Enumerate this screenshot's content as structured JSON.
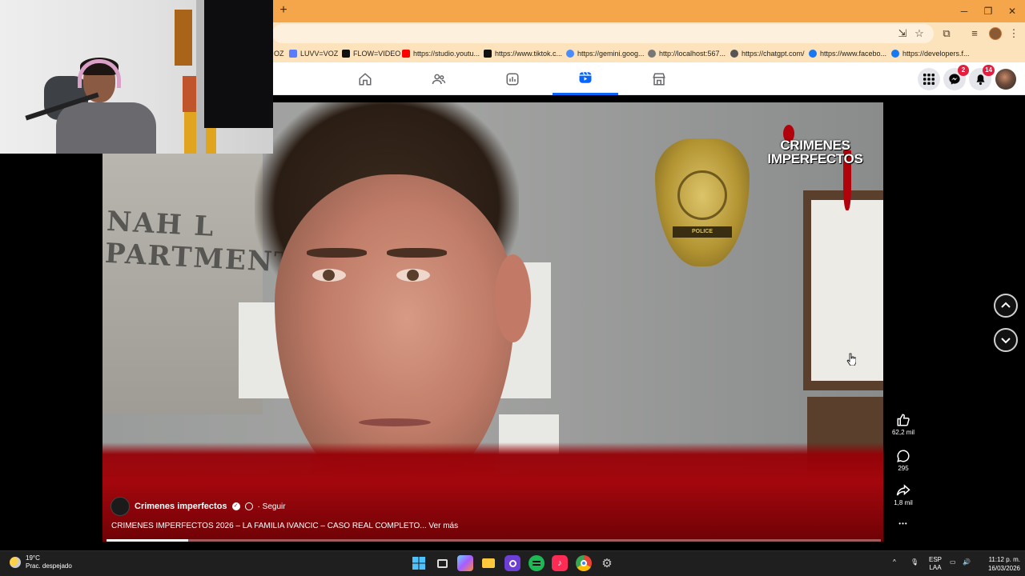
{
  "browser": {
    "new_tab_glyph": "+",
    "window_controls": [
      "─",
      "❐",
      "✕"
    ],
    "bookmarks": [
      {
        "label": "OZ",
        "icon_color": "#999999"
      },
      {
        "label": "LUVV=VOZ",
        "icon_color": "#5b7cff"
      },
      {
        "label": "FLOW=VIDEO",
        "icon_color": "#111111"
      },
      {
        "label": "https://studio.youtu...",
        "icon_color": "#ff0000"
      },
      {
        "label": "https://www.tiktok.c...",
        "icon_color": "#111111"
      },
      {
        "label": "https://gemini.goog...",
        "icon_color": "#4a8cff"
      },
      {
        "label": "http://localhost:567...",
        "icon_color": "#777777"
      },
      {
        "label": "https://chatgpt.com/",
        "icon_color": "#555555"
      },
      {
        "label": "https://www.facebo...",
        "icon_color": "#1877f2"
      },
      {
        "label": "https://developers.f...",
        "icon_color": "#1877f2"
      }
    ]
  },
  "facebook": {
    "nav_tabs": [
      {
        "name": "home-icon",
        "active": false
      },
      {
        "name": "friends-icon",
        "active": false
      },
      {
        "name": "feeds-icon",
        "active": false
      },
      {
        "name": "reels-icon",
        "active": true
      },
      {
        "name": "marketplace-icon",
        "active": false
      }
    ],
    "messenger_badge": "2",
    "notifications_badge": "14",
    "accent": "#0866ff"
  },
  "reel": {
    "brand_line1": "CRIMENES",
    "brand_line2": "IMPERFECTOS",
    "author": "Crimenes imperfectos",
    "follow_label": "· Seguir",
    "caption": "CRIMENES IMPERFECTOS 2026 – LA FAMILIA IVANCIC – CASO REAL COMPLETO...",
    "see_more": "Ver más",
    "progress_fraction": 0.105,
    "likes": "62,2 mil",
    "comments": "295",
    "shares": "1,8 mil",
    "more_glyph": "•••"
  },
  "taskbar": {
    "temp": "19°C",
    "weather_desc": "Prac. despejado",
    "lang_top": "ESP",
    "lang_bottom": "LAA",
    "time": "11:12 p. m.",
    "date": "16/03/2026"
  }
}
